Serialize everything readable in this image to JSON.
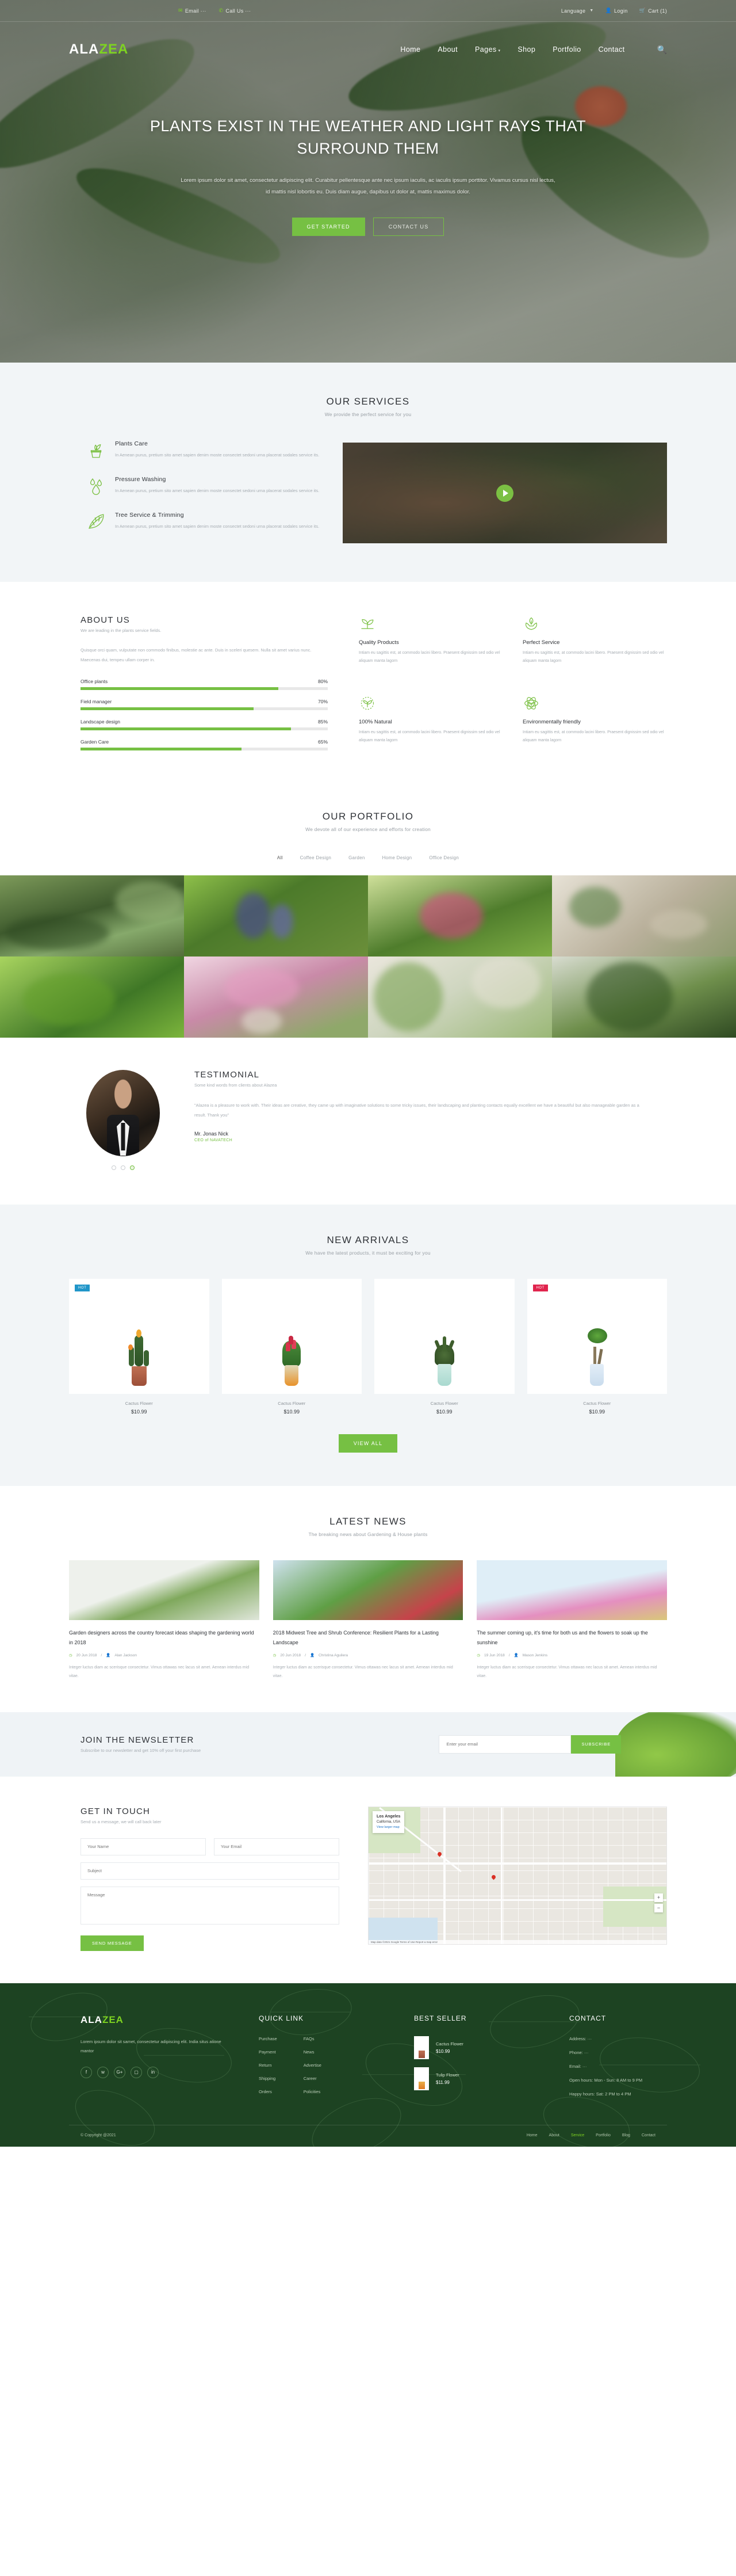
{
  "topbar": {
    "email": "Email ···",
    "call": "Call Us ···",
    "language": "Language",
    "login": "Login",
    "cart": "Cart (1)",
    "icons": [
      "envelope-icon",
      "phone-icon",
      "globe-icon",
      "user-icon",
      "cart-icon"
    ]
  },
  "nav": {
    "logo_a": "ALA",
    "logo_b": "ZEA",
    "items": [
      "Home",
      "About",
      "Pages",
      "Shop",
      "Portfolio",
      "Contact"
    ],
    "search_icon": "search-icon"
  },
  "hero": {
    "title": "PLANTS EXIST IN THE WEATHER AND LIGHT RAYS THAT SURROUND THEM",
    "paragraph": "Lorem ipsum dolor sit amet, consectetur adipiscing elit. Curabitur pellentesque ante nec ipsum iaculis, ac iaculis ipsum porttitor. Vivamus cursus nisl lectus, id mattis nisl lobortis eu. Duis diam augue, dapibus ut dolor at, mattis maximus dolor.",
    "btn_primary": "GET STARTED",
    "btn_secondary": "CONTACT US"
  },
  "services": {
    "title": "OUR SERVICES",
    "subtitle": "We provide the perfect service for you",
    "items": [
      {
        "icon": "potted-plant-icon",
        "title": "Plants Care",
        "text": "In Aenean purus, pretium sito amet sapien denim moste consectet sedoni urna placerat sodales service its."
      },
      {
        "icon": "water-drops-icon",
        "title": "Pressure Washing",
        "text": "In Aenean purus, pretium sito amet sapien denim moste consectet sedoni urna placerat sodales service its."
      },
      {
        "icon": "leaf-branch-icon",
        "title": "Tree Service & Trimming",
        "text": "In Aenean purus, pretium sito amet sapien denim moste consectet sedoni urna placerat sodales service its."
      }
    ],
    "video_play": "play-button"
  },
  "about": {
    "title": "ABOUT US",
    "subtitle": "We are leading in the plants service fields.",
    "paragraph": "Quisque orci quam, vulputate non commodo finibus, molestie ac ante. Duis in sceleri quesem. Nulla sit amet varius nunc. Maecenas dui, tempeu ullam corper in.",
    "skills": [
      {
        "label": "Office plants",
        "pct": 80
      },
      {
        "label": "Field manager",
        "pct": 70
      },
      {
        "label": "Landscape design",
        "pct": 85
      },
      {
        "label": "Garden Care",
        "pct": 65
      }
    ],
    "features": [
      {
        "icon": "sprout-icon",
        "title": "Quality Products",
        "text": "Intiam eu sagittis est, at commodo lacini libero. Praesent dignissim sed odio vel aliquam manta lagorn"
      },
      {
        "icon": "hands-leaf-icon",
        "title": "Perfect Service",
        "text": "Intiam eu sagittis est, at commodo lacini libero. Praesent dignissim sed odio vel aliquam manta lagorn"
      },
      {
        "icon": "natural-badge-icon",
        "title": "100% Natural",
        "text": "Intiam eu sagittis est, at commodo lacini libero. Praesent dignissim sed odio vel aliquam manta lagorn"
      },
      {
        "icon": "eco-atom-icon",
        "title": "Environmentally friendly",
        "text": "Intiam eu sagittis est, at commodo lacini libero. Praesent dignissim sed odio vel aliquam manta lagorn"
      }
    ]
  },
  "portfolio": {
    "title": "OUR PORTFOLIO",
    "subtitle": "We devote all of our experience and efforts for creation",
    "filters": [
      "All",
      "Coffee Design",
      "Garden",
      "Home Design",
      "Office Design"
    ],
    "active_filter": "All",
    "tiles": [
      "garden-pond",
      "blue-muscari",
      "pink-bromeliad",
      "desk-plant",
      "green-fern",
      "pink-peonies",
      "hanging-plants",
      "indoor-palm"
    ]
  },
  "testimonial": {
    "title": "TESTIMONIAL",
    "subtitle": "Some kind words from clients about Alazea",
    "quote": "\"Alazea is a pleasure to work with. Their ideas are creative, they came up with imaginative solutions to some tricky issues, their landscaping and planting contacts equally excellent we have a beautiful but also manageable garden as a result. Thank you\"",
    "name": "Mr. Jonas Nick",
    "role": "CEO of NAVATECH",
    "dots": 3,
    "active_dot": 3
  },
  "arrivals": {
    "title": "NEW ARRIVALS",
    "subtitle": "We have the latest products, it must be exciting for you",
    "view_all": "VIEW ALL",
    "products": [
      {
        "badge": "HOT",
        "badge_type": "hot",
        "name": "Cactus Flower",
        "price": "$10.99",
        "pot": "#b5644a",
        "plant": "cactus"
      },
      {
        "badge": "",
        "badge_type": "",
        "name": "Cactus Flower",
        "price": "$10.99",
        "pot": "#e79a2c",
        "plant": "tulip"
      },
      {
        "badge": "",
        "badge_type": "",
        "name": "Cactus Flower",
        "price": "$10.99",
        "pot": "#b8e4dd",
        "plant": "aloe"
      },
      {
        "badge": "HOT",
        "badge_type": "sale",
        "name": "Cactus Flower",
        "price": "$10.99",
        "pot": "#cfe3f2",
        "plant": "bonsai"
      }
    ]
  },
  "news": {
    "title": "LATEST NEWS",
    "subtitle": "The breaking news about Gardening & House plants",
    "posts": [
      {
        "title": "Garden designers across the country forecast ideas shaping the gardening world in 2018",
        "date": "20 Jun 2018",
        "author": "Alan Jackson",
        "text": "Integer luctus diam ac scerisque consectetur. Vimus ottawas nec lacus sit amet. Aenean interdus mid vitae."
      },
      {
        "title": "2018 Midwest Tree and Shrub Conference: Resilient Plants for a Lasting Landscape",
        "date": "20 Jun 2018",
        "author": "Christina Aguilera",
        "text": "Integer luctus diam ac scerisque consectetur. Vimus ottawas nec lacus sit amet. Aenean interdus mid vitae."
      },
      {
        "title": "The summer coming up, it's time for both us and the flowers to soak up the sunshine",
        "date": "19 Jun 2018",
        "author": "Mason Jenkins",
        "text": "Integer luctus diam ac scerisque consectetur. Vimus ottawas nec lacus sit amet. Aenean interdus mid vitae."
      }
    ]
  },
  "newsletter": {
    "title": "JOIN THE NEWSLETTER",
    "subtitle": "Subscribe to our newsletter and get 10% off your first purchase",
    "placeholder": "Enter your email",
    "button": "SUBSCRIBE"
  },
  "contact": {
    "title": "GET IN TOUCH",
    "subtitle": "Send us a message, we will call back later",
    "name_ph": "Your Name",
    "email_ph": "Your Email",
    "subject_ph": "Subject",
    "message_ph": "Message",
    "button": "SEND MESSAGE",
    "map": {
      "card_title": "Los Angeles",
      "card_sub": "California, USA",
      "card_link": "View larger map",
      "zoom_in": "+",
      "zoom_out": "−",
      "attribution": "Map data ©2021 Google   Terms of Use   Report a map error"
    }
  },
  "footer": {
    "logo_a": "ALA",
    "logo_b": "ZEA",
    "about": "Lorem ipsum dolor sit samet, consectetur adipiscing elit. India situs atione mantor",
    "socials": [
      "facebook-icon",
      "twitter-icon",
      "google-plus-icon",
      "instagram-icon",
      "linkedin-icon"
    ],
    "quick_link_title": "QUICK LINK",
    "quick_links_col1": [
      "Purchase",
      "Payment",
      "Return",
      "Shipping",
      "Orders"
    ],
    "quick_links_col2": [
      "FAQs",
      "News",
      "Advertise",
      "Career",
      "Policities"
    ],
    "best_seller_title": "BEST SELLER",
    "best_sellers": [
      {
        "name": "Cactus Flower",
        "price": "$10.99"
      },
      {
        "name": "Tulip Flower",
        "price": "$11.99"
      }
    ],
    "contact_title": "CONTACT",
    "contact_items": [
      "Address: ···",
      "Phone: ···",
      "Email: ···",
      "Open hours: Mon - Sun: 8 AM to 9 PM",
      "Happy hours: Sat: 2 PM to 4 PM"
    ],
    "copyright": "© Copyright @2021",
    "bottom_links": [
      "Home",
      "About",
      "Service",
      "Portfolio",
      "Blog",
      "Contact"
    ],
    "bottom_active": "Service"
  },
  "colors": {
    "green": "#76c043",
    "bright_green": "#7ed321",
    "dark_green": "#1d4322",
    "hot_badge": "#2196c9",
    "sale_badge": "#e0244d"
  }
}
